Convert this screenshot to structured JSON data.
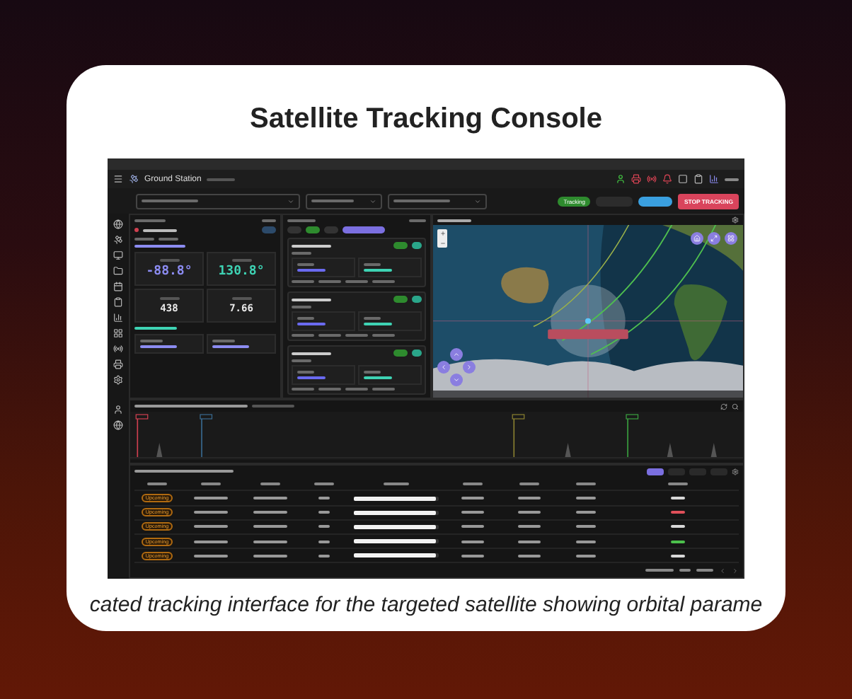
{
  "page": {
    "title": "Satellite Tracking Console",
    "caption": "cated tracking interface for the targeted satellite showing orbital parame"
  },
  "app": {
    "brand": "Ground Station",
    "status_pill": "Tracking",
    "stop_button": "STOP TRACKING",
    "position": [
      {
        "value": "-88.8°",
        "color": "#8c8cf2"
      },
      {
        "value": "130.8°",
        "color": "#3ed3b4"
      },
      {
        "value": "438",
        "color": "#e8e8e8"
      },
      {
        "value": "7.66",
        "color": "#e8e8e8"
      }
    ],
    "filters": [
      {
        "selected": true
      },
      {
        "selected": false
      },
      {
        "selected": false
      },
      {
        "selected": false
      }
    ],
    "passes": [
      {
        "status": "Upcoming",
        "level": 0.97,
        "color": "#d8d8d8"
      },
      {
        "status": "Upcoming",
        "level": 0.97,
        "color": "#e0505a"
      },
      {
        "status": "Upcoming",
        "level": 0.97,
        "color": "#d8d8d8"
      },
      {
        "status": "Upcoming",
        "level": 0.97,
        "color": "#4cc04c"
      },
      {
        "status": "Upcoming",
        "level": 0.97,
        "color": "#d8d8d8"
      }
    ]
  }
}
